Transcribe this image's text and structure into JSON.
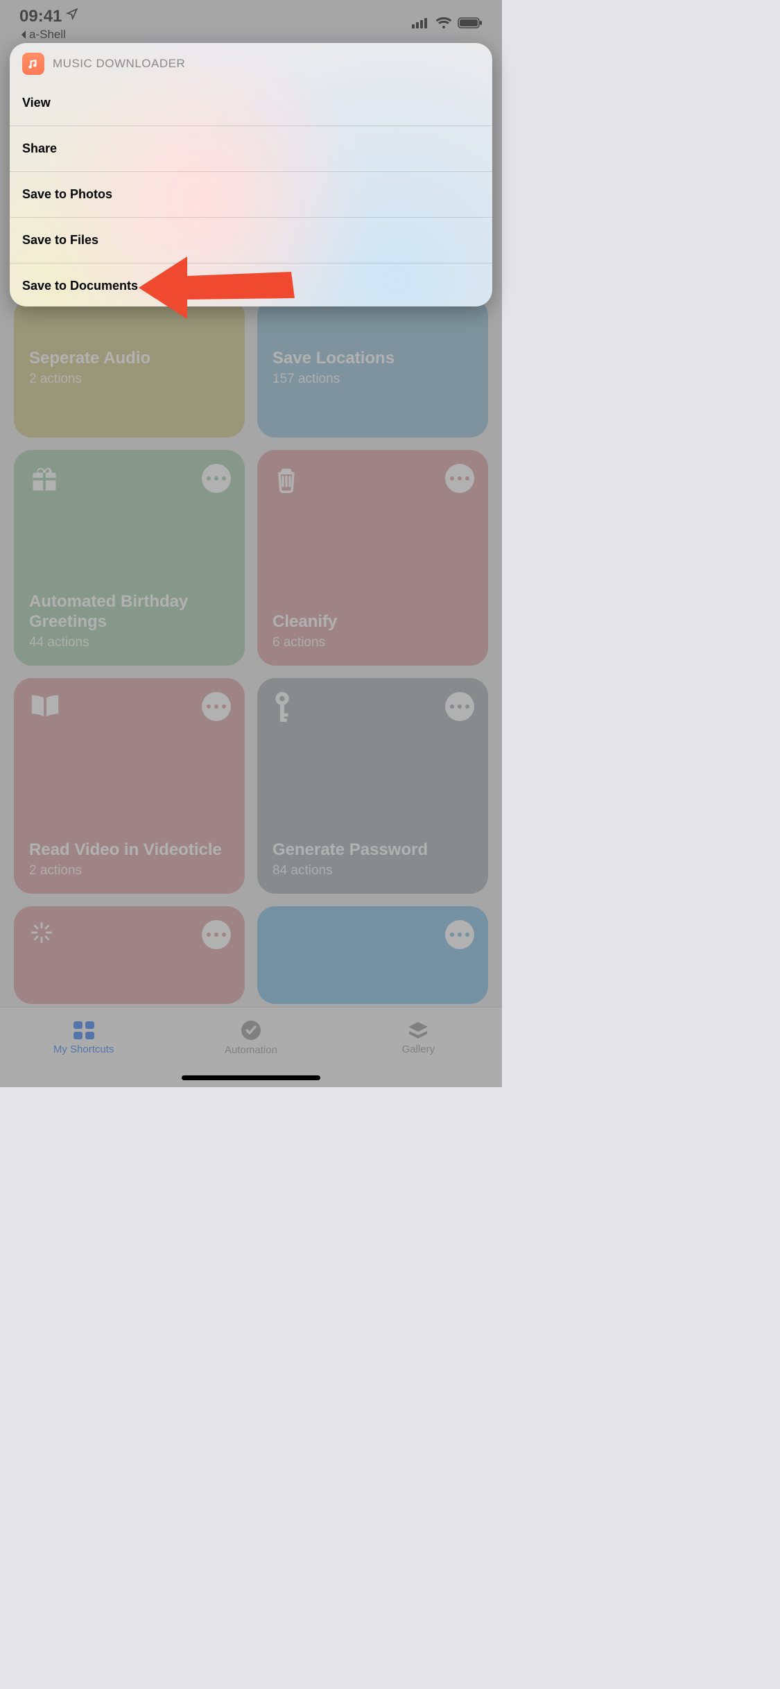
{
  "status_bar": {
    "time": "09:41",
    "back_app": "a-Shell"
  },
  "action_sheet": {
    "title": "MUSIC DOWNLOADER",
    "items": [
      "View",
      "Share",
      "Save to Photos",
      "Save to Files",
      "Save to Documents"
    ]
  },
  "shortcuts": [
    {
      "title": "Seperate Audio",
      "subtitle": "2 actions"
    },
    {
      "title": "Save Locations",
      "subtitle": "157 actions"
    },
    {
      "title": "Automated Birthday Greetings",
      "subtitle": "44 actions"
    },
    {
      "title": "Cleanify",
      "subtitle": "6 actions"
    },
    {
      "title": "Read Video in Videoticle",
      "subtitle": "2 actions"
    },
    {
      "title": "Generate Password",
      "subtitle": "84 actions"
    }
  ],
  "tabs": {
    "shortcuts": "My Shortcuts",
    "automation": "Automation",
    "gallery": "Gallery"
  }
}
